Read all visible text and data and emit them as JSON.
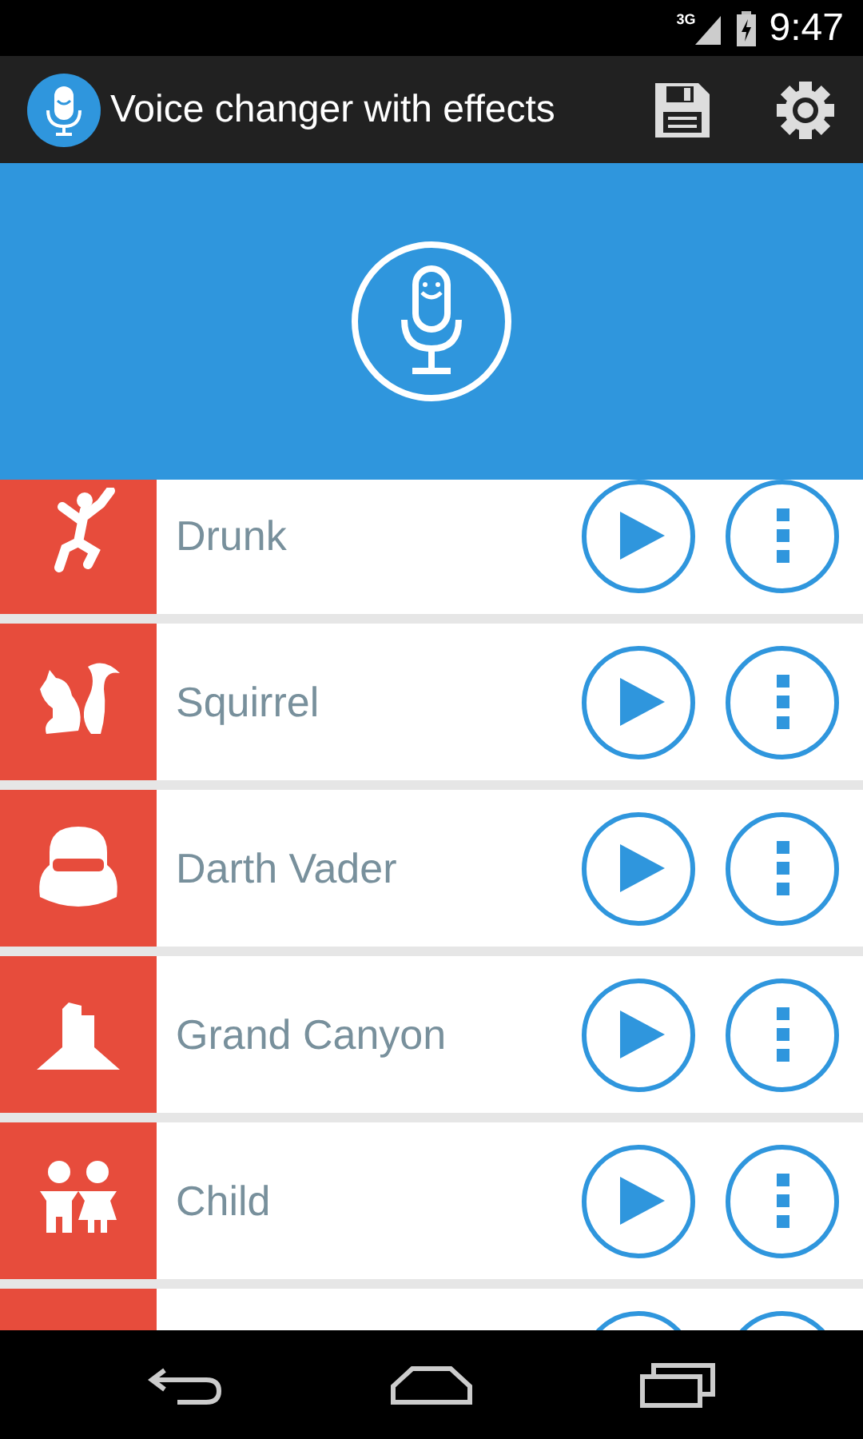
{
  "status_bar": {
    "network": "3G",
    "time": "9:47"
  },
  "app_bar": {
    "title": "Voice changer with effects"
  },
  "effects": [
    {
      "label": "Drunk"
    },
    {
      "label": "Squirrel"
    },
    {
      "label": "Darth Vader"
    },
    {
      "label": "Grand Canyon"
    },
    {
      "label": "Child"
    }
  ],
  "more_rows_below": true
}
